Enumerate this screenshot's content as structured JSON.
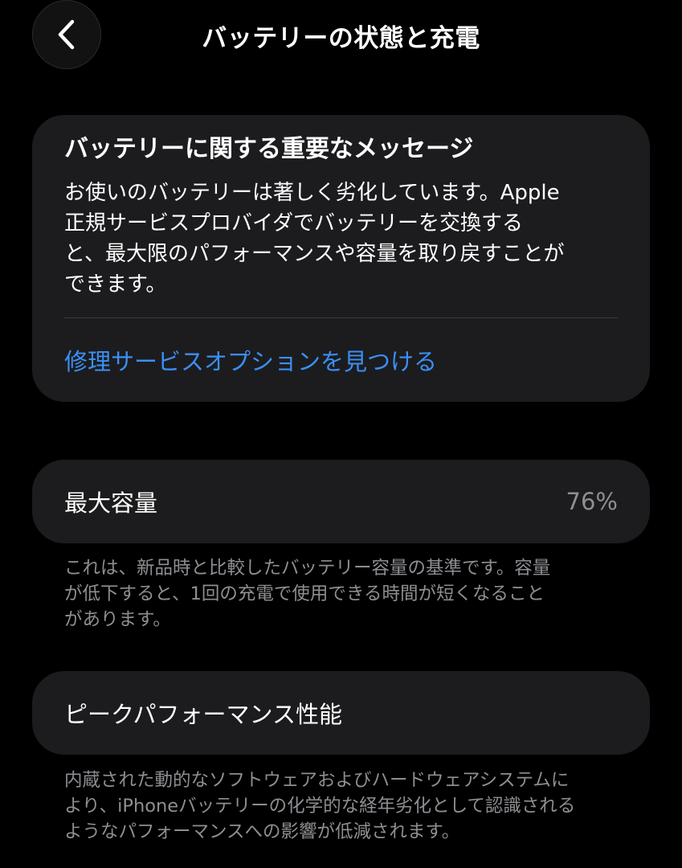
{
  "nav": {
    "title": "バッテリーの状態と充電",
    "back_icon": "chevron-left-icon"
  },
  "message_card": {
    "title": "バッテリーに関する重要なメッセージ",
    "body_lines": [
      "お使いのバッテリーは著しく劣化しています。Apple",
      "正規サービスプロバイダでバッテリーを交換する",
      "と、最大限のパフォーマンスや容量を取り戻すことが",
      "できます。"
    ],
    "link_label": "修理サービスオプションを見つける"
  },
  "max_capacity": {
    "label": "最大容量",
    "value": "76%",
    "footnote_lines": [
      "これは、新品時と比較したバッテリー容量の基準です。容量",
      "が低下すると、1回の充電で使用できる時間が短くなること",
      "があります。"
    ]
  },
  "peak_performance": {
    "label": "ピークパフォーマンス性能",
    "footnote_lines": [
      "内蔵された動的なソフトウェアおよびハードウェアシステムに",
      "より、iPhoneバッテリーの化学的な経年劣化として認識される",
      "ようなパフォーマンスへの影響が低減されます。"
    ]
  },
  "colors": {
    "background": "#000000",
    "card": "#1c1c1e",
    "link": "#3b8ff5",
    "secondary_text": "#8e8e93"
  }
}
